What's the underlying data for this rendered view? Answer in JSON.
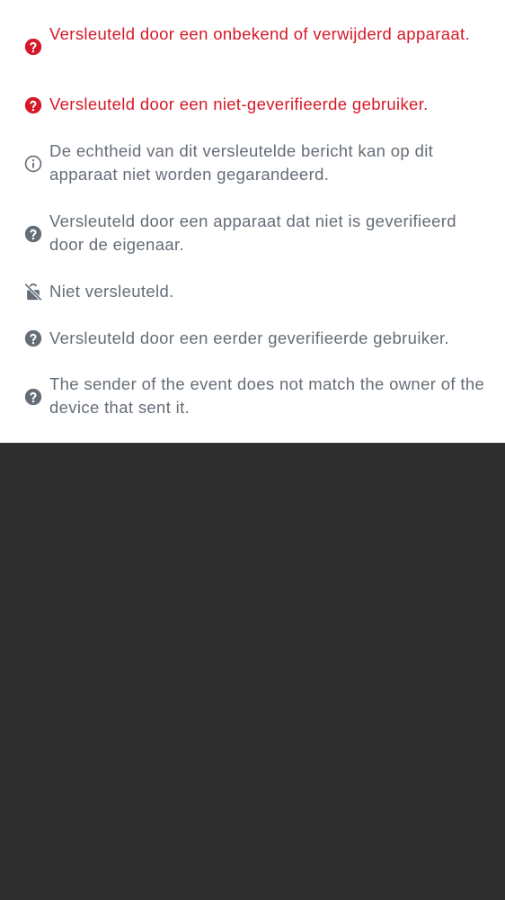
{
  "colors": {
    "critical": "#d51928",
    "muted": "#656d77",
    "background": "#ffffff",
    "lower_area": "#2e2e2e"
  },
  "shield_legend": {
    "items": [
      {
        "icon": "red-question-circle-icon",
        "severity": "critical",
        "text": "Versleuteld door een onbekend of verwijderd apparaat."
      },
      {
        "icon": "red-question-circle-icon",
        "severity": "critical",
        "text": "Versleuteld door een niet-geverifieerde gebruiker."
      },
      {
        "icon": "info-circle-icon",
        "severity": "info",
        "text": "De echtheid van dit versleutelde bericht kan op dit apparaat niet worden gegarandeerd."
      },
      {
        "icon": "grey-question-circle-icon",
        "severity": "info",
        "text": "Versleuteld door een apparaat dat niet is geverifieerd door de eigenaar."
      },
      {
        "icon": "lock-off-icon",
        "severity": "info",
        "text": "Niet versleuteld."
      },
      {
        "icon": "grey-question-circle-icon",
        "severity": "info",
        "text": "Versleuteld door een eerder geverifieerde gebruiker."
      },
      {
        "icon": "grey-question-circle-icon",
        "severity": "info",
        "text": "The sender of the event does not match the owner of the device that sent it."
      }
    ]
  }
}
